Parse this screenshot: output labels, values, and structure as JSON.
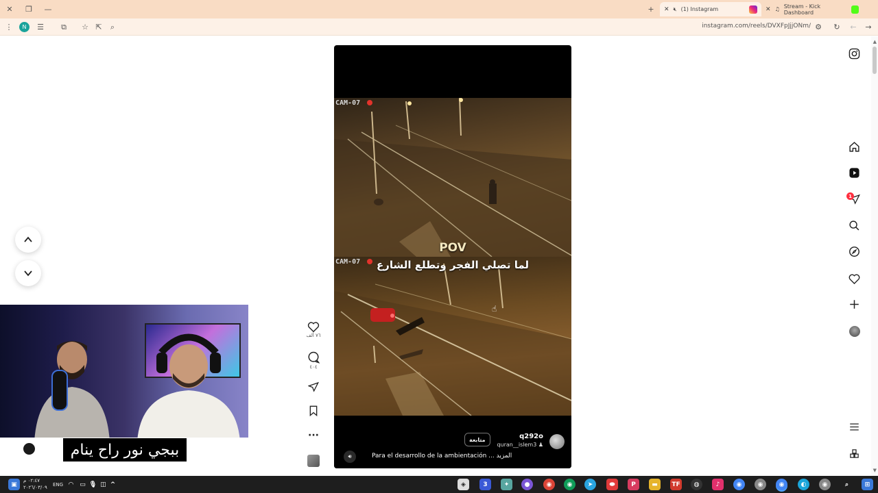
{
  "browser": {
    "tabs": [
      {
        "title": "(1) Instagram",
        "active": true
      },
      {
        "title": "Stream - Kick Dashboard",
        "active": false
      }
    ],
    "url": "instagram.com/reels/DVXFpJjjONm/",
    "profile_initial": "N"
  },
  "reel": {
    "cam_label_top": "CAM-07",
    "cam_label_bottom": "CAM-07",
    "pov_text": "POV",
    "arabic_caption": "لما تصلي الفجر وتطلع الشارع",
    "follow_label": "متابعة",
    "username": "q292o",
    "audio": "quran__islem3",
    "caption": "Para el desarrollo de la ambientación ... المزيد"
  },
  "actions": {
    "likes": "٧٦ ألف",
    "comments": "٤٠٤"
  },
  "right_nav": {
    "notification_count": "1"
  },
  "overlay": {
    "subtitle": "ببجي نور راح ينام"
  },
  "taskbar": {
    "lang": "ENG",
    "time": "٠٢:٤٧ م",
    "date": "٢٠٢٦/٠٣/٠٩"
  },
  "colors": {
    "tabbar": "#f9dcc4",
    "toolbar": "#fdf1e7",
    "instagram_red": "#ff3040",
    "reel_bg": "#000000"
  }
}
